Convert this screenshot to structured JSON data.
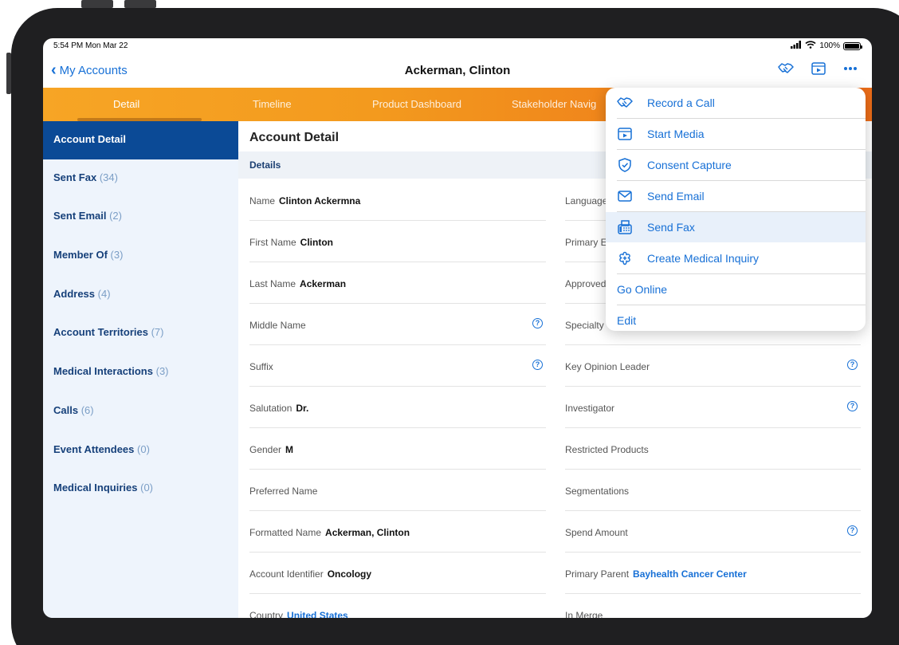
{
  "status_bar": {
    "time": "5:54 PM  Mon Mar 22",
    "battery": "100%"
  },
  "nav": {
    "back_label": "My Accounts",
    "title": "Ackerman, Clinton",
    "icons": [
      "handshake-icon",
      "media-icon",
      "more-icon"
    ]
  },
  "tabs": [
    {
      "label": "Detail",
      "active": true
    },
    {
      "label": "Timeline"
    },
    {
      "label": "Product Dashboard"
    },
    {
      "label": "Stakeholder Navig"
    }
  ],
  "sidebar": {
    "items": [
      {
        "label": "Account Detail",
        "count": "",
        "active": true
      },
      {
        "label": "Sent Fax",
        "count": "(34)"
      },
      {
        "label": "Sent Email",
        "count": "(2)"
      },
      {
        "label": "Member Of",
        "count": "(3)"
      },
      {
        "label": "Address",
        "count": "(4)"
      },
      {
        "label": "Account Territories",
        "count": "(7)"
      },
      {
        "label": "Medical Interactions",
        "count": "(3)"
      },
      {
        "label": "Calls",
        "count": "(6)"
      },
      {
        "label": "Event Attendees",
        "count": "(0)"
      },
      {
        "label": "Medical Inquiries",
        "count": "(0)"
      }
    ]
  },
  "main": {
    "title": "Account Detail",
    "section": "Details",
    "left_fields": [
      {
        "label": "Name",
        "value": "Clinton Ackermna"
      },
      {
        "label": "First Name",
        "value": "Clinton"
      },
      {
        "label": "Last Name",
        "value": "Ackerman"
      },
      {
        "label": "Middle Name",
        "value": "",
        "help": "?"
      },
      {
        "label": "Suffix",
        "value": "",
        "help": "?"
      },
      {
        "label": "Salutation",
        "value": "Dr."
      },
      {
        "label": "Gender",
        "value": "M"
      },
      {
        "label": "Preferred Name",
        "value": ""
      },
      {
        "label": "Formatted Name",
        "value": "Ackerman, Clinton"
      },
      {
        "label": "Account Identifier",
        "value": "Oncology"
      },
      {
        "label": "Country",
        "value": "United States",
        "link": true
      }
    ],
    "right_fields": [
      {
        "label": "Language",
        "value": ""
      },
      {
        "label": "Primary E",
        "value": ""
      },
      {
        "label": "Approved",
        "value": ""
      },
      {
        "label": "Specialty",
        "value": ""
      },
      {
        "label": "Key Opinion Leader",
        "value": "",
        "help": "?"
      },
      {
        "label": "Investigator",
        "value": "",
        "help": "?"
      },
      {
        "label": "Restricted Products",
        "value": ""
      },
      {
        "label": "Segmentations",
        "value": ""
      },
      {
        "label": "Spend Amount",
        "value": "",
        "help": "?"
      },
      {
        "label": "Primary Parent",
        "value": "Bayhealth Cancer Center",
        "link": true
      },
      {
        "label": "In Merge",
        "value": ""
      }
    ]
  },
  "menu": {
    "items": [
      {
        "label": "Record a Call",
        "icon": "handshake-icon"
      },
      {
        "label": "Start Media",
        "icon": "media-icon"
      },
      {
        "label": "Consent Capture",
        "icon": "shield-check-icon"
      },
      {
        "label": "Send Email",
        "icon": "envelope-icon"
      },
      {
        "label": "Send Fax",
        "icon": "fax-icon",
        "highlighted": true
      },
      {
        "label": "Create Medical Inquiry",
        "icon": "medical-icon"
      },
      {
        "label": "Go Online",
        "icon": ""
      },
      {
        "label": "Edit",
        "icon": ""
      }
    ]
  },
  "colors": {
    "accent": "#1770d6",
    "tab_orange": "#f39a1e",
    "sidebar_active": "#0b4a96",
    "sidebar_bg": "#eef4fc"
  }
}
